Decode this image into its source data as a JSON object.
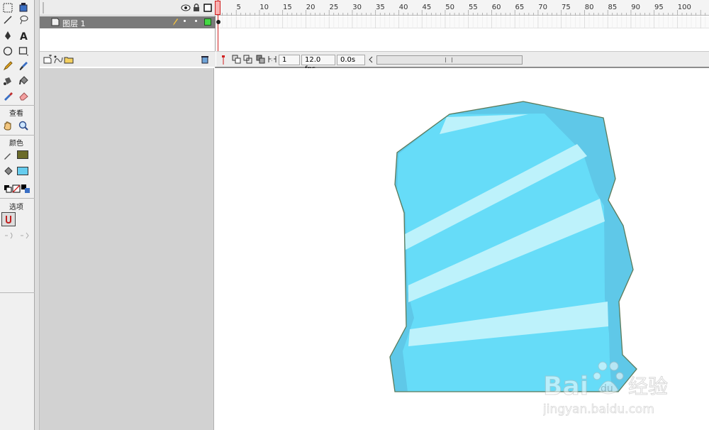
{
  "timeline": {
    "ruler_labels": [
      "5",
      "10",
      "15",
      "20",
      "25",
      "30",
      "35",
      "40",
      "45",
      "50",
      "55",
      "60",
      "65",
      "70",
      "75",
      "80",
      "85",
      "90",
      "95",
      "100"
    ],
    "layer_name": "图层 1",
    "current_frame": "1",
    "fps": "12.0 fps",
    "elapsed": "0.0s"
  },
  "tools": {
    "section_view": "查看",
    "section_colors": "颜色",
    "section_options": "选项",
    "stroke_color": "#6b6b2a",
    "fill_color": "#66ccee"
  },
  "drawing": {
    "shape_main_color": "#66dcf8",
    "shape_shadow_color": "#5fc8e8",
    "stripe_color": "#bdf2fb",
    "outline_color": "#5a7a5a"
  },
  "watermark": {
    "brand": "Bai",
    "brand_suffix": "经验",
    "url": "jingyan.baidu.com"
  }
}
